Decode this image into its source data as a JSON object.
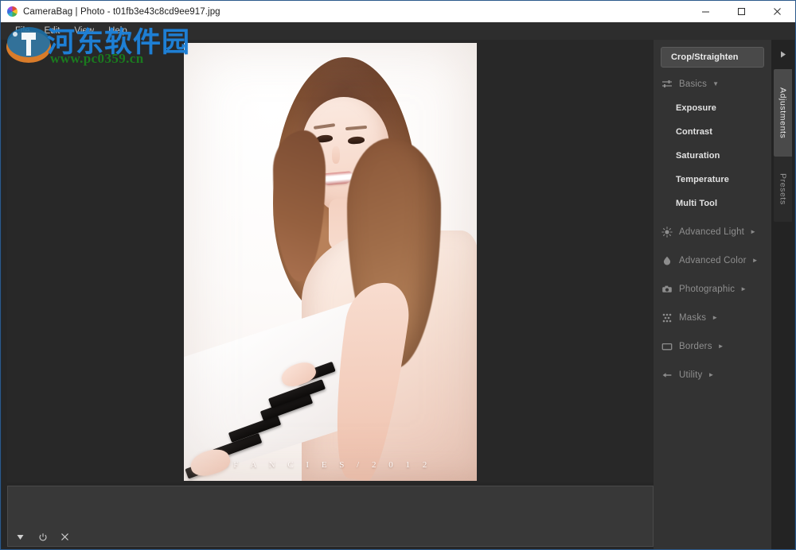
{
  "window": {
    "title": "CameraBag | Photo - t01fb3e43c8cd9ee917.jpg",
    "app_icon": "camerabag-color-wheel-icon",
    "controls": {
      "minimize": "minimize-icon",
      "maximize": "maximize-icon",
      "close": "close-icon"
    }
  },
  "menubar": {
    "items": [
      {
        "label": "File"
      },
      {
        "label": "Edit"
      },
      {
        "label": "View"
      },
      {
        "label": "Help"
      }
    ]
  },
  "canvas": {
    "photo": {
      "caption": "F A N C I E S / 2 0 1 2"
    }
  },
  "bottom_panel": {
    "tools": [
      {
        "name": "expand-triangle-icon",
        "glyph": "triangle-down"
      },
      {
        "name": "power-icon",
        "glyph": "power"
      },
      {
        "name": "close-icon",
        "glyph": "x"
      }
    ]
  },
  "right_panel": {
    "crop_button": "Crop/Straighten",
    "categories": [
      {
        "label": "Basics",
        "icon": "sliders-icon",
        "expanded": true,
        "arrow": "▼",
        "items": [
          {
            "label": "Exposure"
          },
          {
            "label": "Contrast"
          },
          {
            "label": "Saturation"
          },
          {
            "label": "Temperature"
          },
          {
            "label": "Multi Tool"
          }
        ]
      },
      {
        "label": "Advanced Light",
        "icon": "sun-icon",
        "expanded": false,
        "arrow": "►",
        "items": []
      },
      {
        "label": "Advanced Color",
        "icon": "color-drop-icon",
        "expanded": false,
        "arrow": "►",
        "items": []
      },
      {
        "label": "Photographic",
        "icon": "camera-icon",
        "expanded": false,
        "arrow": "►",
        "items": []
      },
      {
        "label": "Masks",
        "icon": "mask-grid-icon",
        "expanded": false,
        "arrow": "►",
        "items": []
      },
      {
        "label": "Borders",
        "icon": "border-rect-icon",
        "expanded": false,
        "arrow": "►",
        "items": []
      },
      {
        "label": "Utility",
        "icon": "wrench-icon",
        "expanded": false,
        "arrow": "►",
        "items": []
      }
    ]
  },
  "edge_tabs": {
    "toggle_icon": "collapse-arrow-right-icon",
    "tabs": [
      {
        "label": "Adjustments",
        "active": true
      },
      {
        "label": "Presets",
        "active": false
      }
    ]
  },
  "watermark": {
    "site_name": "河东软件园",
    "url": "www.pc0359.cn",
    "logo": "pc0359-logo-icon"
  },
  "colors": {
    "panel_bg": "#333333",
    "canvas_bg": "#282828",
    "menu_bg": "#2d2d2d",
    "accent_blue": "#1e7fd4",
    "accent_green": "#1a7a1e",
    "active_tab": "#4a4a4a",
    "window_border": "#2c5a8c"
  }
}
